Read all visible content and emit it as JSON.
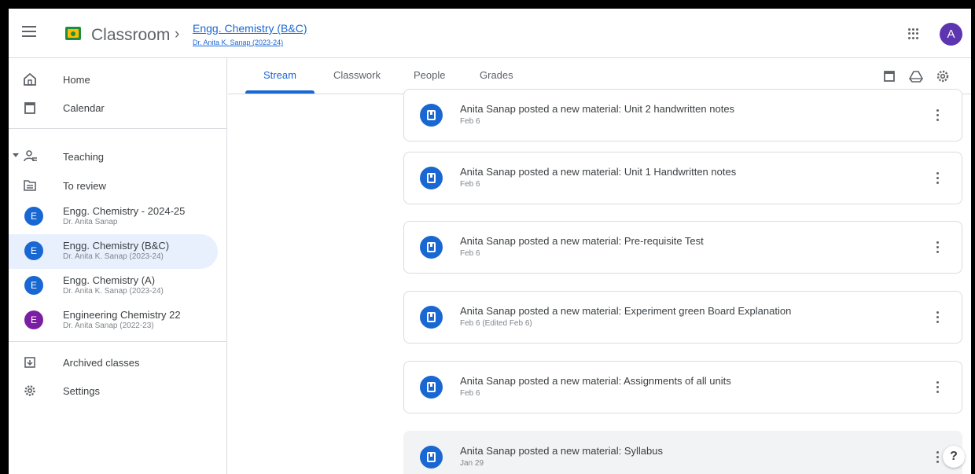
{
  "header": {
    "app_name": "Classroom",
    "breadcrumb_sep": "›",
    "class_title": "Engg. Chemistry (B&C)",
    "class_subtitle": "Dr. Anita K. Sanap (2023-24)",
    "avatar_letter": "A",
    "accent": "#1967d2"
  },
  "sidebar": {
    "home": "Home",
    "calendar": "Calendar",
    "teaching": "Teaching",
    "to_review": "To review",
    "classes": [
      {
        "letter": "E",
        "name": "Engg. Chemistry - 2024-25",
        "sub": "Dr. Anita Sanap",
        "color": "#1967d2"
      },
      {
        "letter": "E",
        "name": "Engg. Chemistry (B&C)",
        "sub": "Dr. Anita K. Sanap (2023-24)",
        "color": "#1967d2"
      },
      {
        "letter": "E",
        "name": "Engg. Chemistry (A)",
        "sub": "Dr. Anita K. Sanap (2023-24)",
        "color": "#1967d2"
      },
      {
        "letter": "E",
        "name": "Engineering Chemistry 22",
        "sub": "Dr. Anita Sanap (2022-23)",
        "color": "#7b1fa2"
      }
    ],
    "archived": "Archived classes",
    "settings": "Settings"
  },
  "tabs": [
    "Stream",
    "Classwork",
    "People",
    "Grades"
  ],
  "posts": [
    {
      "title": "Anita Sanap posted a new material: Unit 2 handwritten notes",
      "date": "Feb 6"
    },
    {
      "title": "Anita Sanap posted a new material: Unit 1 Handwritten notes",
      "date": "Feb 6"
    },
    {
      "title": "Anita Sanap posted a new material: Pre-requisite Test",
      "date": "Feb 6"
    },
    {
      "title": "Anita Sanap posted a new material: Experiment green Board Explanation",
      "date": "Feb 6 (Edited Feb 6)"
    },
    {
      "title": "Anita Sanap posted a new material: Assignments of all units",
      "date": "Feb 6"
    },
    {
      "title": "Anita Sanap posted a new material: Syllabus",
      "date": "Jan 29"
    }
  ],
  "help_label": "?"
}
